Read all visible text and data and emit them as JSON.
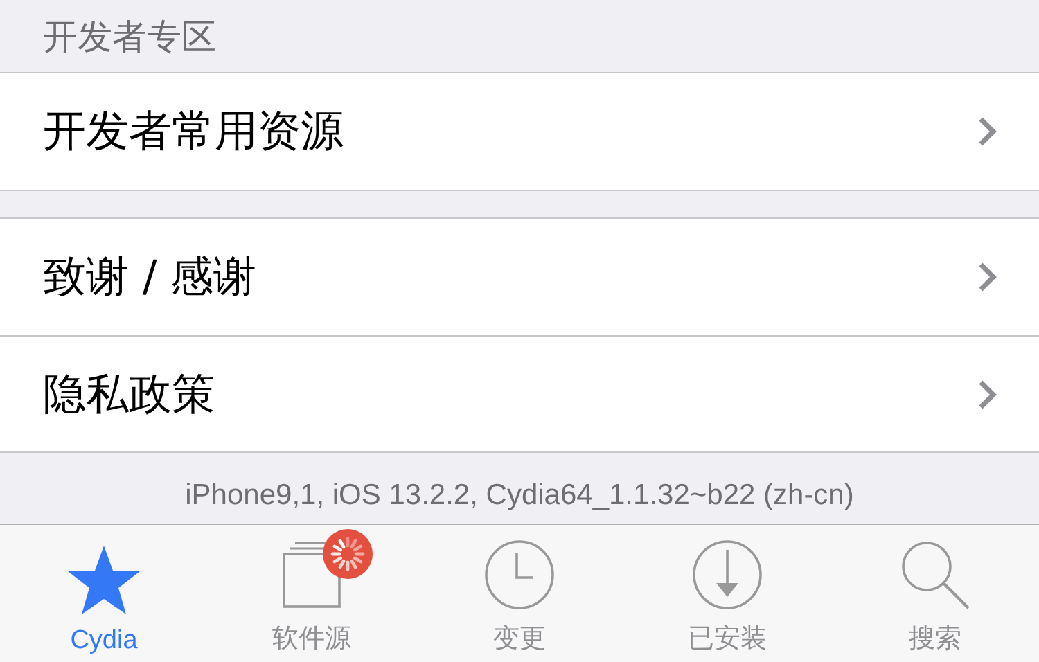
{
  "sections": [
    {
      "header": "开发者专区",
      "rows": [
        {
          "label": "开发者常用资源"
        }
      ]
    },
    {
      "rows": [
        {
          "label": "致谢 / 感谢"
        },
        {
          "label": "隐私政策"
        }
      ]
    }
  ],
  "footer": "iPhone9,1, iOS 13.2.2, Cydia64_1.1.32~b22 (zh-cn)",
  "tab_bar": [
    {
      "label": "Cydia",
      "kind": "star",
      "selected": true,
      "loading": false
    },
    {
      "label": "软件源",
      "kind": "sources",
      "selected": false,
      "loading": true
    },
    {
      "label": "变更",
      "kind": "clock",
      "selected": false,
      "loading": false
    },
    {
      "label": "已安装",
      "kind": "download",
      "selected": false,
      "loading": false
    },
    {
      "label": "搜索",
      "kind": "search",
      "selected": false,
      "loading": false
    }
  ]
}
